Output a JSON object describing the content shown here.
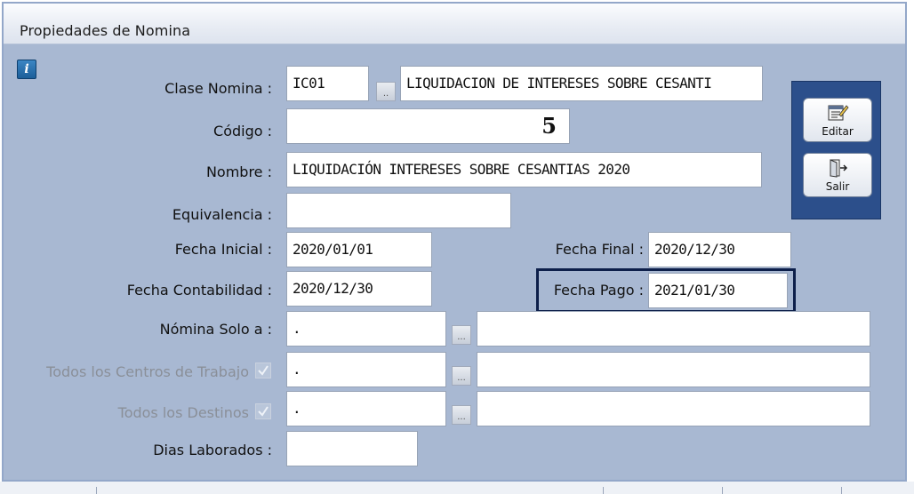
{
  "window": {
    "title": "Propiedades de Nomina"
  },
  "info_icon_glyph": "i",
  "form": {
    "clase_nomina": {
      "label": "Clase Nomina :",
      "code": "IC01",
      "lookup": "..",
      "description": "LIQUIDACION DE INTERESES SOBRE CESANTI"
    },
    "codigo": {
      "label": "Código :",
      "value": "5"
    },
    "nombre": {
      "label": "Nombre :",
      "value": "LIQUIDACIÓN INTERESES SOBRE CESANTIAS 2020"
    },
    "equivalencia": {
      "label": "Equivalencia :",
      "value": ""
    },
    "fecha_inicial": {
      "label": "Fecha Inicial :",
      "value": "2020/01/01"
    },
    "fecha_final": {
      "label": "Fecha Final :",
      "value": "2020/12/30"
    },
    "fecha_contabilidad": {
      "label": "Fecha Contabilidad :",
      "value": "2020/12/30"
    },
    "fecha_pago": {
      "label": "Fecha Pago :",
      "value": "2021/01/30"
    },
    "nomina_solo_a": {
      "label": "Nómina Solo a :",
      "code": ".",
      "lookup": "...",
      "description": ""
    },
    "todos_centros": {
      "label": "Todos los Centros de Trabajo",
      "checked": true,
      "code": ".",
      "lookup": "...",
      "description": ""
    },
    "todos_destinos": {
      "label": "Todos los Destinos",
      "checked": true,
      "code": ".",
      "lookup": "...",
      "description": ""
    },
    "dias_laborados": {
      "label": "Dias Laborados :",
      "value": ""
    }
  },
  "actions": {
    "editar": {
      "label": "Editar",
      "icon": "edit-form-icon"
    },
    "salir": {
      "label": "Salir",
      "icon": "exit-door-icon"
    }
  },
  "colors": {
    "panel_background": "#a8b8d2",
    "actions_panel": "#2c4f8b",
    "highlight_border": "#0d1f4a"
  }
}
